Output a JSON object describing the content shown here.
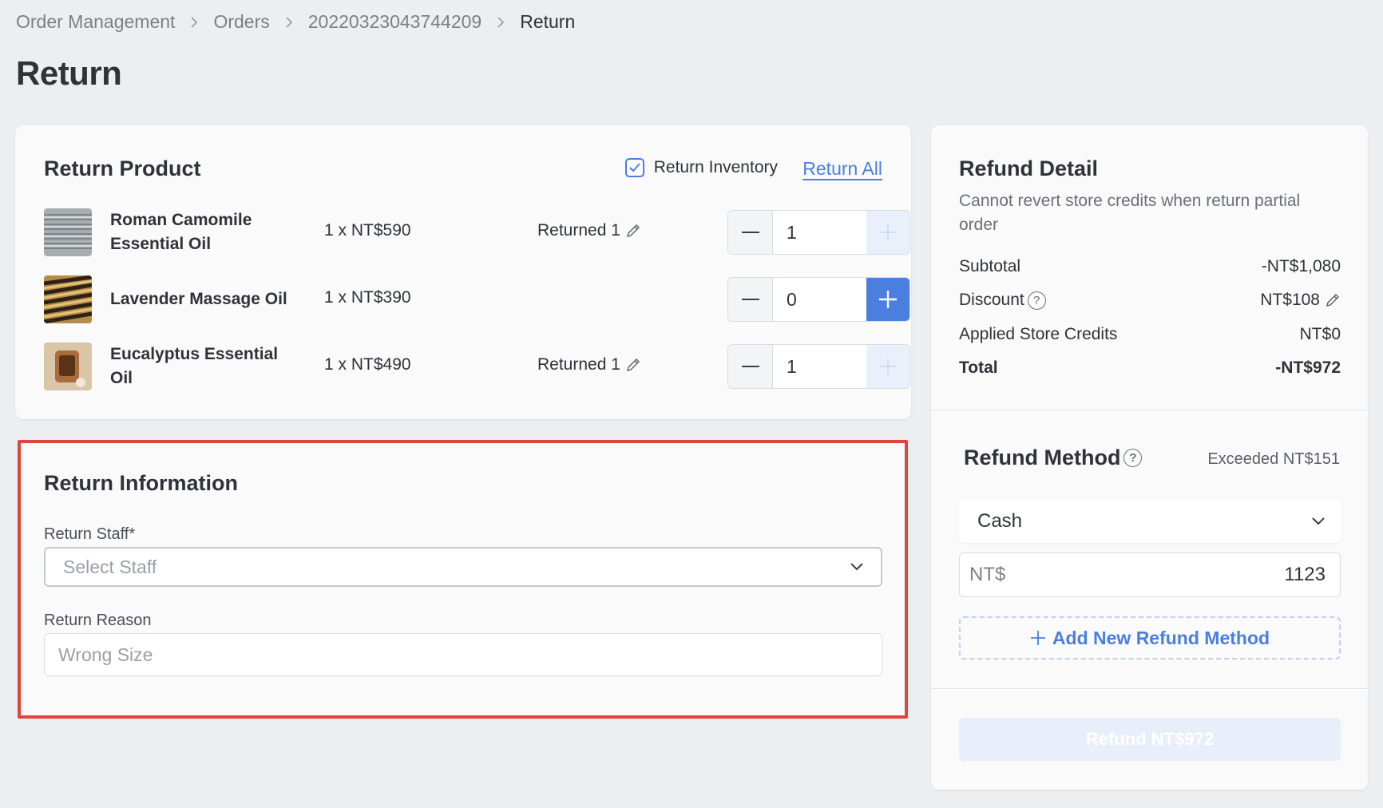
{
  "breadcrumb": {
    "items": [
      "Order Management",
      "Orders",
      "20220323043744209"
    ],
    "current": "Return"
  },
  "page_title": "Return",
  "return_product": {
    "title": "Return Product",
    "inventory_label": "Return Inventory",
    "inventory_checked": true,
    "return_all_label": "Return All",
    "products": [
      {
        "name_line1": "Roman Camomile",
        "name_line2": "Essential Oil",
        "qty_price": "1 x NT$590",
        "returned": "Returned 1",
        "quantity": "1",
        "plus_state": "disabled"
      },
      {
        "name_line1": "Lavender Massage Oil",
        "name_line2": "",
        "qty_price": "1 x NT$390",
        "returned": "",
        "quantity": "0",
        "plus_state": "active"
      },
      {
        "name_line1": "Eucalyptus Essential",
        "name_line2": "Oil",
        "qty_price": "1 x NT$490",
        "returned": "Returned 1",
        "quantity": "1",
        "plus_state": "disabled"
      }
    ]
  },
  "return_information": {
    "title": "Return Information",
    "staff_label": "Return Staff*",
    "staff_placeholder": "Select Staff",
    "reason_label": "Return Reason",
    "reason_placeholder": "Wrong Size"
  },
  "refund_detail": {
    "title": "Refund Detail",
    "note": "Cannot revert store credits when return partial order",
    "subtotal_label": "Subtotal",
    "subtotal_value": "-NT$1,080",
    "discount_label": "Discount",
    "discount_value": "NT$108",
    "credits_label": "Applied Store Credits",
    "credits_value": "NT$0",
    "total_label": "Total",
    "total_value": "-NT$972"
  },
  "refund_method": {
    "title": "Refund Method",
    "exceeded": "Exceeded NT$151",
    "selected_method": "Cash",
    "currency_prefix": "NT$",
    "amount": "1123",
    "add_label": "Add New Refund Method",
    "refund_button": "Refund NT$972"
  },
  "colors": {
    "accent": "#4a7fe0",
    "highlight_border": "#e0443a",
    "background": "#edeef0"
  }
}
